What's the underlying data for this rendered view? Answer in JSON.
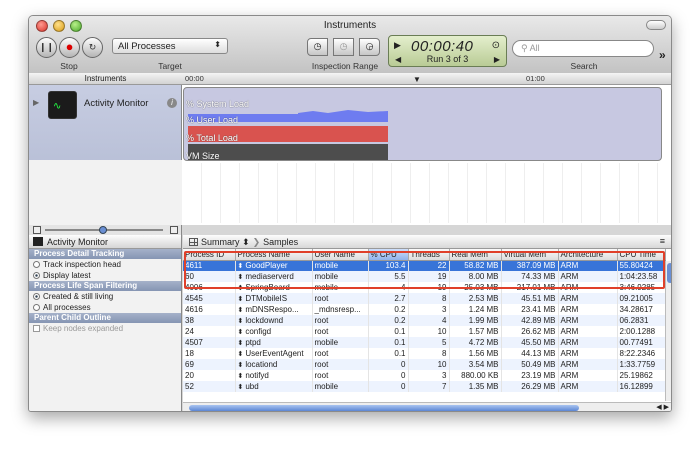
{
  "window": {
    "title": "Instruments"
  },
  "toolbar": {
    "stop_label": "Stop",
    "target_label": "Target",
    "target_value": "All Processes",
    "inspection_label": "Inspection Range",
    "timer": "00:00:40",
    "run_label": "Run 3 of 3",
    "search_placeholder": "All",
    "search_label": "Search"
  },
  "ruler": {
    "instruments_label": "Instruments",
    "ticks": [
      "00:00",
      "01:00"
    ]
  },
  "instrument": {
    "name": "Activity Monitor",
    "tracks": [
      "% System Load",
      "% User Load",
      "% Total Load",
      "VM Size"
    ]
  },
  "sidebar": {
    "header": "Activity Monitor",
    "sections": [
      {
        "title": "Process Detail Tracking",
        "options": [
          {
            "label": "Track inspection head",
            "type": "radio",
            "checked": false
          },
          {
            "label": "Display latest",
            "type": "radio",
            "checked": true
          }
        ]
      },
      {
        "title": "Process Life Span Filtering",
        "options": [
          {
            "label": "Created & still living",
            "type": "radio",
            "checked": true
          },
          {
            "label": "All processes",
            "type": "radio",
            "checked": false
          }
        ]
      },
      {
        "title": "Parent Child Outline",
        "options": [
          {
            "label": "Keep nodes expanded",
            "type": "check",
            "checked": false
          }
        ]
      }
    ]
  },
  "detail": {
    "view": "Summary",
    "breadcrumb": "Samples",
    "columns": [
      "Process ID",
      "Process Name",
      "User Name",
      "% CPU",
      "Threads",
      "Real Mem",
      "Virtual Mem",
      "Architecture",
      "CPU Time"
    ],
    "rows": [
      [
        "4611",
        "GoodPlayer",
        "mobile",
        "103.4",
        "22",
        "58.82 MB",
        "387.09 MB",
        "ARM",
        "55.80424"
      ],
      [
        "60",
        "mediaserverd",
        "mobile",
        "5.5",
        "19",
        "8.00 MB",
        "74.33 MB",
        "ARM",
        "1:04:23.58"
      ],
      [
        "4006",
        "SpringBoard",
        "mobile",
        "4",
        "19",
        "25.03 MB",
        "217.01 MB",
        "ARM",
        "3:46.9285"
      ],
      [
        "4545",
        "DTMobileIS",
        "root",
        "2.7",
        "8",
        "2.53 MB",
        "45.51 MB",
        "ARM",
        "09.21005"
      ],
      [
        "4616",
        "mDNSRespo...",
        "_mdnsresp...",
        "0.2",
        "3",
        "1.24 MB",
        "23.41 MB",
        "ARM",
        "34.28617"
      ],
      [
        "38",
        "lockdownd",
        "root",
        "0.2",
        "4",
        "1.99 MB",
        "42.89 MB",
        "ARM",
        "06.2831"
      ],
      [
        "24",
        "configd",
        "root",
        "0.1",
        "10",
        "1.57 MB",
        "26.62 MB",
        "ARM",
        "2:00.1288"
      ],
      [
        "4507",
        "ptpd",
        "mobile",
        "0.1",
        "5",
        "4.72 MB",
        "45.50 MB",
        "ARM",
        "00.77491"
      ],
      [
        "18",
        "UserEventAgent",
        "root",
        "0.1",
        "8",
        "1.56 MB",
        "44.13 MB",
        "ARM",
        "8:22.2346"
      ],
      [
        "69",
        "locationd",
        "root",
        "0",
        "10",
        "3.54 MB",
        "50.49 MB",
        "ARM",
        "1:33.7759"
      ],
      [
        "20",
        "notifyd",
        "root",
        "0",
        "3",
        "880.00 KB",
        "23.19 MB",
        "ARM",
        "25.19862"
      ],
      [
        "52",
        "ubd",
        "mobile",
        "0",
        "7",
        "1.35 MB",
        "26.29 MB",
        "ARM",
        "16.12899"
      ]
    ]
  },
  "colors": {
    "selected_row": "#3874d8",
    "highlight": "#e0402a",
    "user_load": "#6e7cf0",
    "total_load": "#d9534f",
    "vm_size": "#4d4d4d"
  }
}
